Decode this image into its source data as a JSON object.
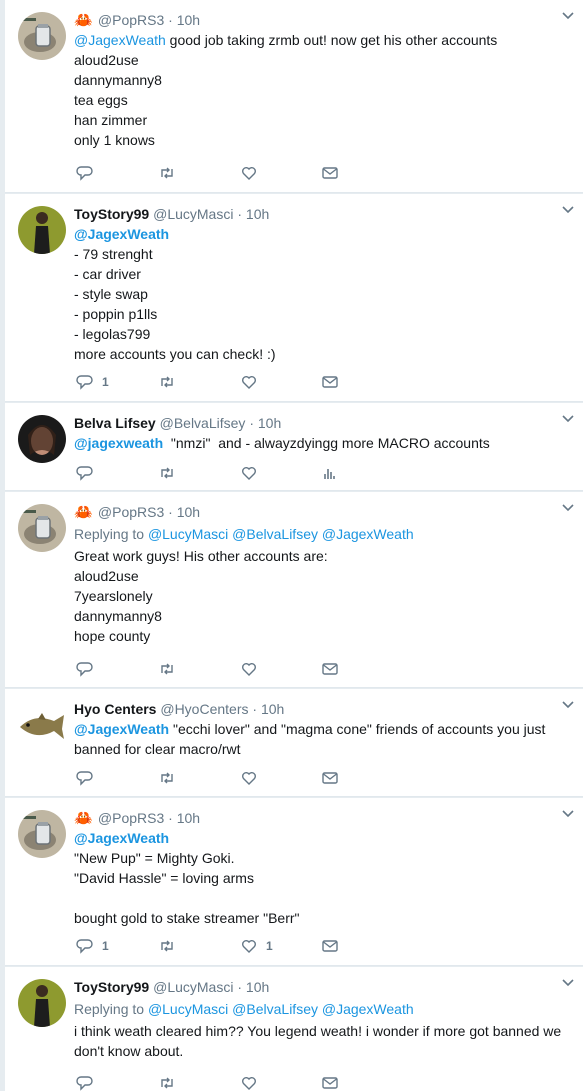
{
  "colors": {
    "accent": "#1b95e0",
    "text": "#14171a",
    "muted": "#657786",
    "background": "#e6ecf0",
    "crab": "#d4383c"
  },
  "icons": {
    "reply": "reply-icon",
    "retweet": "retweet-icon",
    "like": "heart-icon",
    "message": "envelope-icon",
    "analytics": "analytics-icon",
    "menu": "chevron-down-icon"
  },
  "tweets": [
    {
      "avatar": "jar-icon",
      "crab": "🦀",
      "name": "",
      "handle": "@PopRS3",
      "dot": "·",
      "time": "10h",
      "lines": [
        "good job taking zrmb out! now get his other accounts",
        "aloud2use",
        "dannymanny8",
        "tea eggs",
        "han zimmer",
        "only 1 knows"
      ],
      "mention": "@JagexWeath",
      "counts": {
        "reply": "",
        "retweet": "",
        "like": ""
      }
    },
    {
      "avatar": "person-icon",
      "crab": "",
      "name": "ToyStory99",
      "handle": "@LucyMasci",
      "dot": "·",
      "time": "10h",
      "mention": "@JagexWeath",
      "lines": [
        "- 79 strenght",
        "- car driver",
        "- style swap",
        "- poppin p1lls",
        "- legolas799",
        "more accounts you can check! :)"
      ],
      "counts": {
        "reply": "1",
        "retweet": "",
        "like": ""
      }
    },
    {
      "avatar": "face-icon",
      "crab": "",
      "name": "Belva Lifsey",
      "handle": "@BelvaLifsey",
      "dot": "·",
      "time": "10h",
      "mention": "@jagexweath",
      "lines": [
        "  \"nmzi\"  and - alwayzdyingg more MACRO accounts"
      ],
      "counts": {
        "reply": "",
        "retweet": "",
        "like": ""
      }
    },
    {
      "avatar": "jar-icon",
      "crab": "🦀",
      "name": "",
      "handle": "@PopRS3",
      "dot": "·",
      "time": "10h",
      "reply_prefix": "Replying to",
      "reply_to": "@LucyMasci @BelvaLifsey @JagexWeath",
      "lines": [
        "Great work guys! His other accounts are:",
        "aloud2use",
        "7yearslonely",
        "dannymanny8",
        "hope county"
      ],
      "counts": {
        "reply": "",
        "retweet": "",
        "like": ""
      }
    },
    {
      "avatar": "fish-icon",
      "crab": "",
      "name": "Hyo Centers",
      "handle": "@HyoCenters",
      "dot": "·",
      "time": "10h",
      "mention": "@JagexWeath",
      "first_rest": " \"ecchi lover\" and \"magma cone\" friends of accounts you just",
      "lines": [
        "banned for clear macro/rwt"
      ],
      "counts": {
        "reply": "",
        "retweet": "",
        "like": ""
      }
    },
    {
      "avatar": "jar-icon",
      "crab": "🦀",
      "name": "",
      "handle": "@PopRS3",
      "dot": "·",
      "time": "10h",
      "mention": "@JagexWeath",
      "lines": [
        "\"New Pup\" = Mighty Goki.",
        "\"David Hassle\" = loving arms",
        "",
        "bought gold to stake streamer \"Berr\""
      ],
      "counts": {
        "reply": "1",
        "retweet": "",
        "like": "1"
      }
    },
    {
      "avatar": "person-icon",
      "crab": "",
      "name": "ToyStory99",
      "handle": "@LucyMasci",
      "dot": "·",
      "time": "10h",
      "reply_prefix": "Replying to",
      "reply_to": "@LucyMasci @BelvaLifsey @JagexWeath",
      "lines": [
        "i think weath cleared him?? You legend weath! i wonder if more got banned we",
        "don't know about."
      ],
      "counts": {
        "reply": "",
        "retweet": "",
        "like": ""
      }
    }
  ]
}
